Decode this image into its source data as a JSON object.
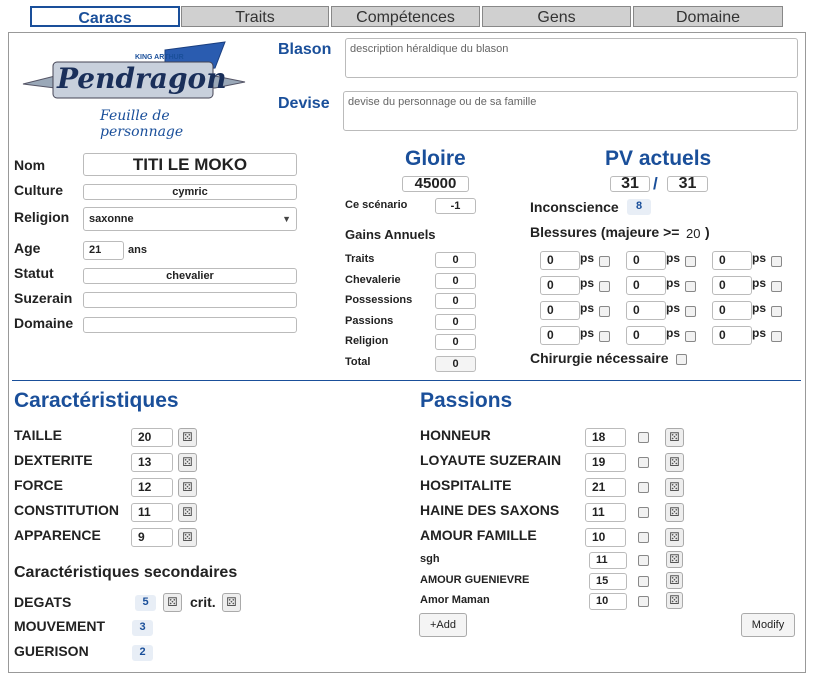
{
  "tabs": [
    "Caracs",
    "Traits",
    "Compétences",
    "Gens",
    "Domaine"
  ],
  "logo": {
    "top": "KING ARTHUR",
    "main": "Pendragon",
    "sub": "Feuille de personnage"
  },
  "blason": {
    "label": "Blason",
    "placeholder": "description héraldique du blason"
  },
  "devise": {
    "label": "Devise",
    "placeholder": "devise du personnage ou de sa famille"
  },
  "identity": {
    "nom_label": "Nom",
    "nom": "TITI LE MOKO",
    "culture_label": "Culture",
    "culture": "cymric",
    "religion_label": "Religion",
    "religion": "saxonne",
    "age_label": "Age",
    "age": "21",
    "age_unit": "ans",
    "statut_label": "Statut",
    "statut": "chevalier",
    "suzerain_label": "Suzerain",
    "suzerain": "",
    "domaine_label": "Domaine",
    "domaine": ""
  },
  "gloire": {
    "title": "Gloire",
    "value": "45000",
    "scenario_label": "Ce scénario",
    "scenario": "-1",
    "gains_title": "Gains Annuels",
    "gains": [
      {
        "label": "Traits",
        "value": "0"
      },
      {
        "label": "Chevalerie",
        "value": "0"
      },
      {
        "label": "Possessions",
        "value": "0"
      },
      {
        "label": "Passions",
        "value": "0"
      },
      {
        "label": "Religion",
        "value": "0"
      }
    ],
    "total_label": "Total",
    "total": "0"
  },
  "pv": {
    "title": "PV actuels",
    "current": "31",
    "sep": "/",
    "max": "31",
    "inconscience_label": "Inconscience",
    "inconscience": "8",
    "blessures_label": "Blessures (majeure >=",
    "blessures_threshold": "20",
    "blessures_close": ")",
    "wound_value": "0",
    "ps": "ps",
    "chirurgie_label": "Chirurgie nécessaire"
  },
  "carac": {
    "title": "Caractéristiques",
    "items": [
      {
        "label": "TAILLE",
        "value": "20"
      },
      {
        "label": "DEXTERITE",
        "value": "13"
      },
      {
        "label": "FORCE",
        "value": "12"
      },
      {
        "label": "CONSTITUTION",
        "value": "11"
      },
      {
        "label": "APPARENCE",
        "value": "9"
      }
    ]
  },
  "secondary": {
    "title": "Caractéristiques secondaires",
    "degats_label": "DEGATS",
    "degats": "5",
    "crit_label": "crit.",
    "mouvement_label": "MOUVEMENT",
    "mouvement": "3",
    "guerison_label": "GUERISON",
    "guerison": "2"
  },
  "passions": {
    "title": "Passions",
    "items": [
      {
        "label": "HONNEUR",
        "value": "18"
      },
      {
        "label": "LOYAUTE SUZERAIN",
        "value": "19"
      },
      {
        "label": "HOSPITALITE",
        "value": "21"
      },
      {
        "label": "HAINE DES SAXONS",
        "value": "11"
      },
      {
        "label": "AMOUR FAMILLE",
        "value": "10"
      }
    ],
    "custom": [
      {
        "label": "sgh",
        "value": "11"
      },
      {
        "label": "AMOUR GUENIEVRE",
        "value": "15"
      },
      {
        "label": "Amor Maman",
        "value": "10"
      }
    ],
    "add_label": "+Add",
    "modify_label": "Modify"
  },
  "icons": {
    "dice": "dice-icon",
    "chevron": "chevron-down-icon"
  },
  "colors": {
    "accent": "#1a4f9a"
  }
}
